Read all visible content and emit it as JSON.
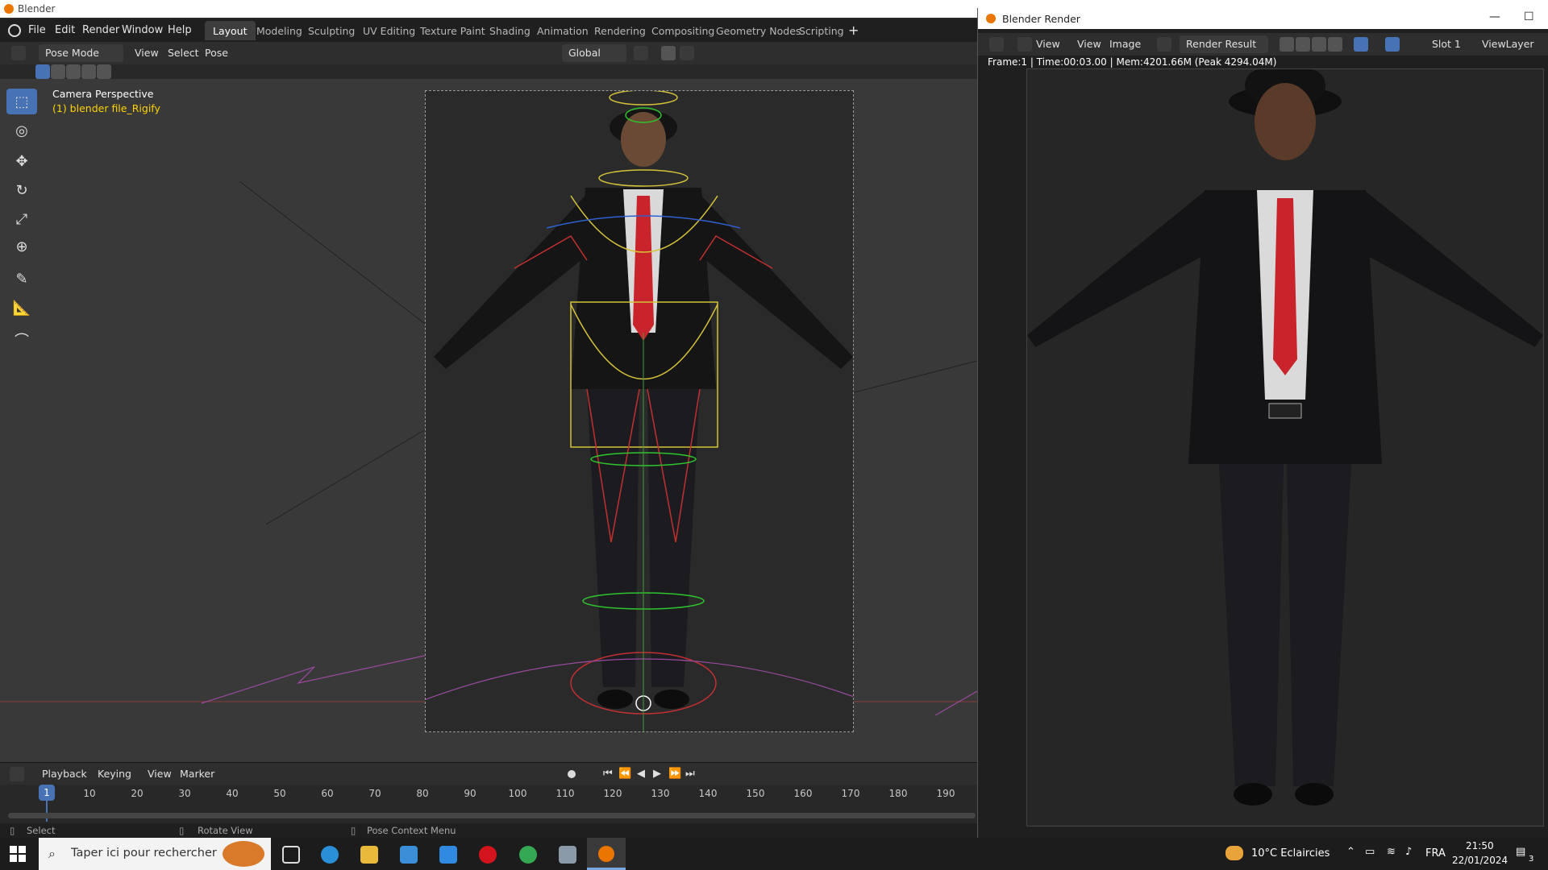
{
  "os": {
    "title": "Blender"
  },
  "menu": {
    "file": "File",
    "edit": "Edit",
    "render": "Render",
    "window": "Window",
    "help": "Help"
  },
  "workspaces": [
    "Layout",
    "Modeling",
    "Sculpting",
    "UV Editing",
    "Texture Paint",
    "Shading",
    "Animation",
    "Rendering",
    "Compositing",
    "Geometry Nodes",
    "Scripting"
  ],
  "header": {
    "mode": "Pose Mode",
    "view": "View",
    "select": "Select",
    "pose": "Pose",
    "orientation": "Global"
  },
  "viewport": {
    "camera_label": "Camera Perspective",
    "object_label": "(1) blender file_Rigify"
  },
  "timeline": {
    "playback": "Playback",
    "keying": "Keying",
    "view": "View",
    "marker": "Marker",
    "current_frame": "1",
    "ticks": [
      "10",
      "20",
      "30",
      "40",
      "50",
      "60",
      "70",
      "80",
      "90",
      "100",
      "110",
      "120",
      "130",
      "140",
      "150",
      "160",
      "170",
      "180",
      "190"
    ]
  },
  "status": {
    "select": "Select",
    "rotate": "Rotate View",
    "context": "Pose Context Menu"
  },
  "render": {
    "title": "Blender Render",
    "view_menu": "View",
    "view": "View",
    "image": "Image",
    "result": "Render Result",
    "slot": "Slot 1",
    "layer": "ViewLayer",
    "info": "Frame:1 | Time:00:03.00 | Mem:4201.66M (Peak 4294.04M)"
  },
  "taskbar": {
    "search_placeholder": "Taper ici pour rechercher",
    "weather": "10°C  Eclaircies",
    "lang": "FRA",
    "time": "21:50",
    "date": "22/01/2024",
    "notif_count": "3"
  },
  "colors": {
    "accent": "#4772b3",
    "blender_orange": "#ea7600",
    "selected_text": "#ffd200"
  }
}
